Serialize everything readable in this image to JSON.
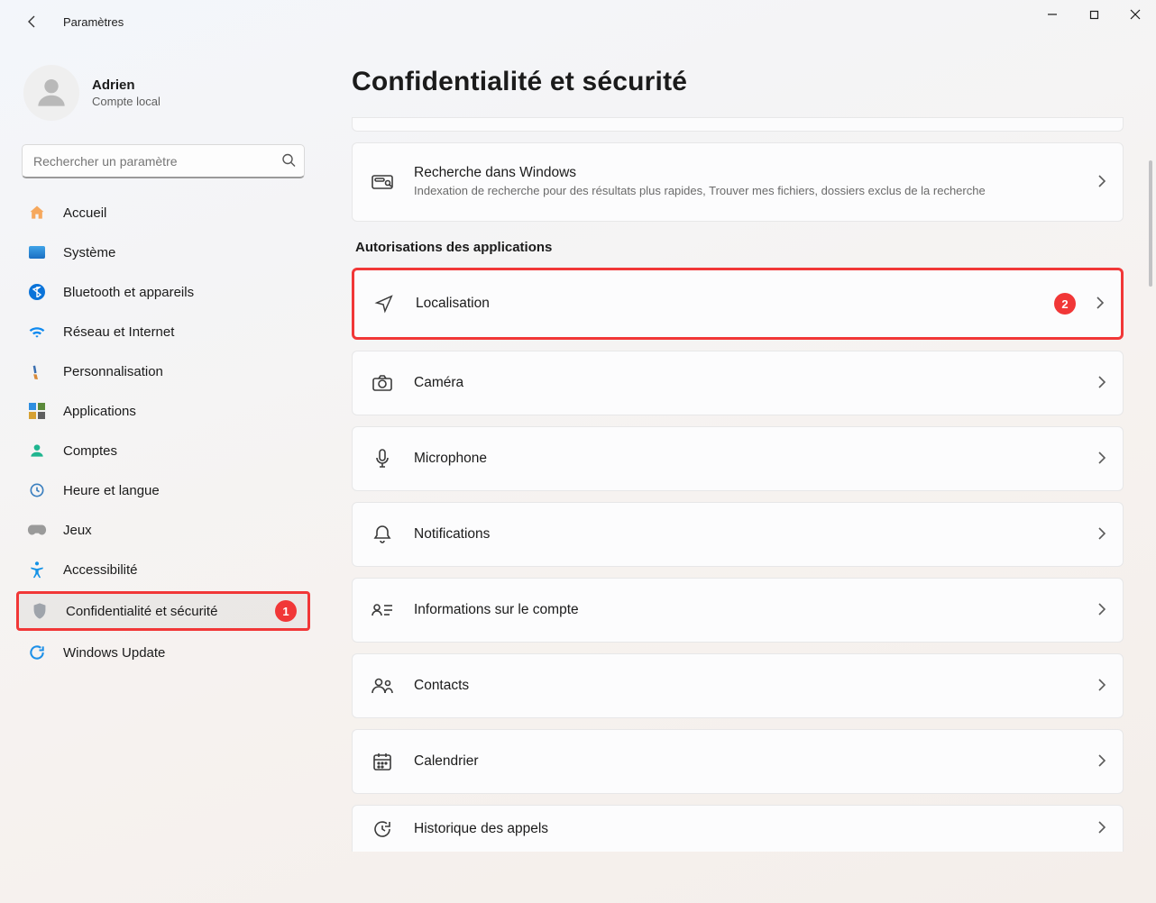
{
  "titlebar": {
    "app_title": "Paramètres"
  },
  "user": {
    "name": "Adrien",
    "subtitle": "Compte local"
  },
  "search": {
    "placeholder": "Rechercher un paramètre"
  },
  "sidebar": {
    "items": [
      {
        "label": "Accueil"
      },
      {
        "label": "Système"
      },
      {
        "label": "Bluetooth et appareils"
      },
      {
        "label": "Réseau et Internet"
      },
      {
        "label": "Personnalisation"
      },
      {
        "label": "Applications"
      },
      {
        "label": "Comptes"
      },
      {
        "label": "Heure et langue"
      },
      {
        "label": "Jeux"
      },
      {
        "label": "Accessibilité"
      },
      {
        "label": "Confidentialité et sécurité"
      },
      {
        "label": "Windows Update"
      }
    ]
  },
  "callouts": {
    "one": "1",
    "two": "2"
  },
  "main": {
    "page_title": "Confidentialité et sécurité",
    "search_windows": {
      "title": "Recherche dans Windows",
      "subtitle": "Indexation de recherche pour des résultats plus rapides, Trouver mes fichiers, dossiers exclus de la recherche"
    },
    "section_app_permissions": "Autorisations des applications",
    "permissions": [
      {
        "label": "Localisation"
      },
      {
        "label": "Caméra"
      },
      {
        "label": "Microphone"
      },
      {
        "label": "Notifications"
      },
      {
        "label": "Informations sur le compte"
      },
      {
        "label": "Contacts"
      },
      {
        "label": "Calendrier"
      },
      {
        "label": "Historique des appels"
      }
    ]
  }
}
